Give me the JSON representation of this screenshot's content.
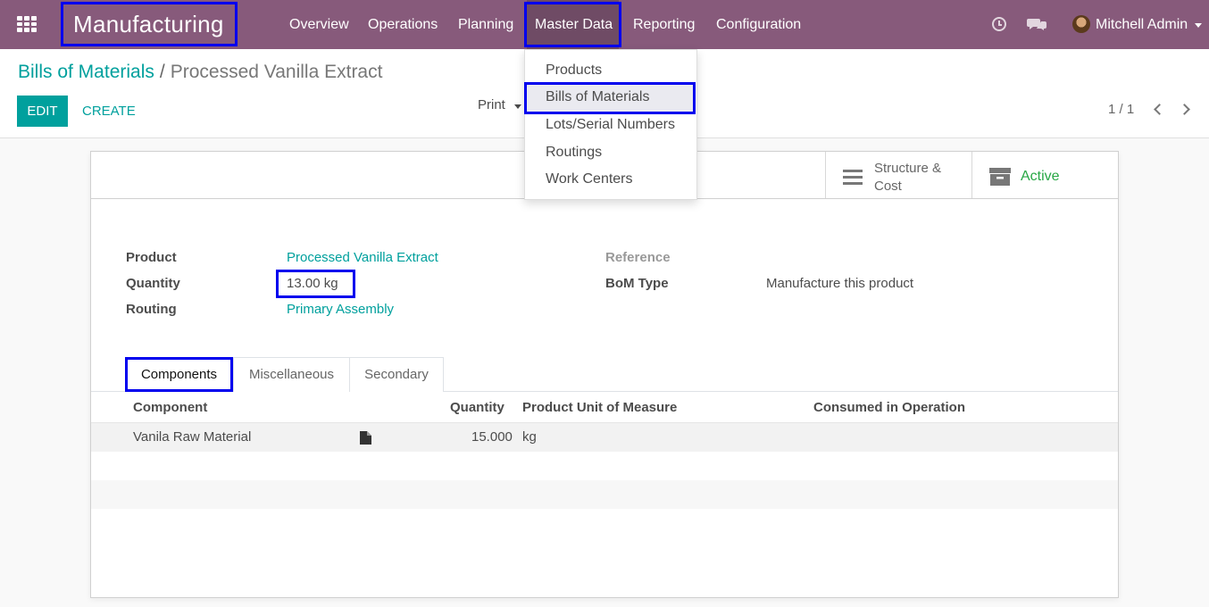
{
  "navbar": {
    "app_name": "Manufacturing",
    "menu": [
      "Overview",
      "Operations",
      "Planning",
      "Master Data",
      "Reporting",
      "Configuration"
    ],
    "active_menu": "Master Data",
    "user_name": "Mitchell Admin",
    "icons": [
      "apps-grid-icon",
      "clock-icon",
      "chat-icon",
      "avatar",
      "caret-down-icon"
    ]
  },
  "breadcrumb": {
    "parent": "Bills of Materials",
    "separator": "/",
    "current": "Processed Vanilla Extract"
  },
  "toolbar": {
    "edit_label": "EDIT",
    "create_label": "CREATE",
    "print_label": "Print",
    "pager": "1 / 1"
  },
  "dropdown": {
    "items": [
      "Products",
      "Bills of Materials",
      "Lots/Serial Numbers",
      "Routings",
      "Work Centers"
    ],
    "selected": "Bills of Materials"
  },
  "button_box": {
    "structure_label": "Structure & Cost",
    "active_label": "Active"
  },
  "form": {
    "product_label": "Product",
    "product_value": "Processed Vanilla Extract",
    "quantity_label": "Quantity",
    "quantity_value": "13.00",
    "quantity_unit": "kg",
    "routing_label": "Routing",
    "routing_value": "Primary Assembly",
    "reference_label": "Reference",
    "reference_value": "",
    "bom_type_label": "BoM Type",
    "bom_type_value": "Manufacture this product"
  },
  "tabs": [
    "Components",
    "Miscellaneous",
    "Secondary"
  ],
  "active_tab": "Components",
  "table": {
    "headers": [
      "Component",
      "Quantity",
      "Product Unit of Measure",
      "Consumed in Operation"
    ],
    "rows": [
      {
        "component": "Vanila Raw Material",
        "quantity": "15.000",
        "uom": "kg",
        "operation": ""
      }
    ]
  },
  "colors": {
    "navbar": "#875a7b",
    "accent": "#00a09d",
    "active_green": "#28a745",
    "highlight_border": "#0000ee"
  }
}
